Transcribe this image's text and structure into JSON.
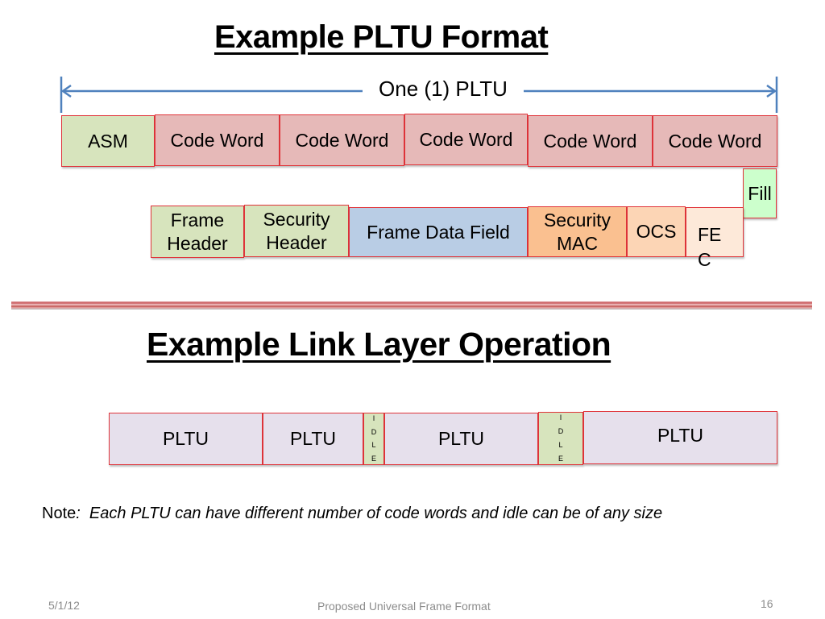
{
  "slide": {
    "title_top": "Example PLTU Format",
    "title_bottom": "Example Link Layer Operation",
    "span_label": "One (1) PLTU",
    "colors": {
      "border": "#e0343a",
      "arrow": "#4f81bd",
      "asm": "#d7e4bd",
      "code_word": "#e6b9b8",
      "frame_data": "#b9cde5",
      "security_mac": "#fac090",
      "ocs": "#fcd5b5",
      "fec": "#fde9d9",
      "fill": "#ccffcc",
      "pltu": "#e6e0ec",
      "idle": "#d7e4bd"
    }
  },
  "pltu_format": {
    "top_row": [
      "ASM",
      "Code Word",
      "Code Word",
      "Code Word",
      "Code Word",
      "Code Word"
    ],
    "fill_label": "Fill",
    "frame_row": [
      {
        "line1": "Frame",
        "line2": "Header"
      },
      {
        "line1": "Security",
        "line2": "Header"
      },
      {
        "line1": "Frame Data Field",
        "line2": ""
      },
      {
        "line1": "Security",
        "line2": "MAC"
      },
      {
        "line1": "OCS",
        "line2": ""
      },
      {
        "line1": "FE",
        "line2": "C"
      }
    ]
  },
  "link_layer": {
    "pltu_label": "PLTU",
    "idle_letters": [
      "I",
      "D",
      "L",
      "E"
    ],
    "sequence": [
      "PLTU",
      "PLTU",
      "IDLE",
      "PLTU",
      "IDLE",
      "PLTU"
    ]
  },
  "note": {
    "prefix": "Note",
    "colon": ":",
    "text": "  Each PLTU can have different number of code words and idle can be of any size"
  },
  "footer": {
    "date": "5/1/12",
    "title": "Proposed Universal Frame Format",
    "page": "16"
  }
}
